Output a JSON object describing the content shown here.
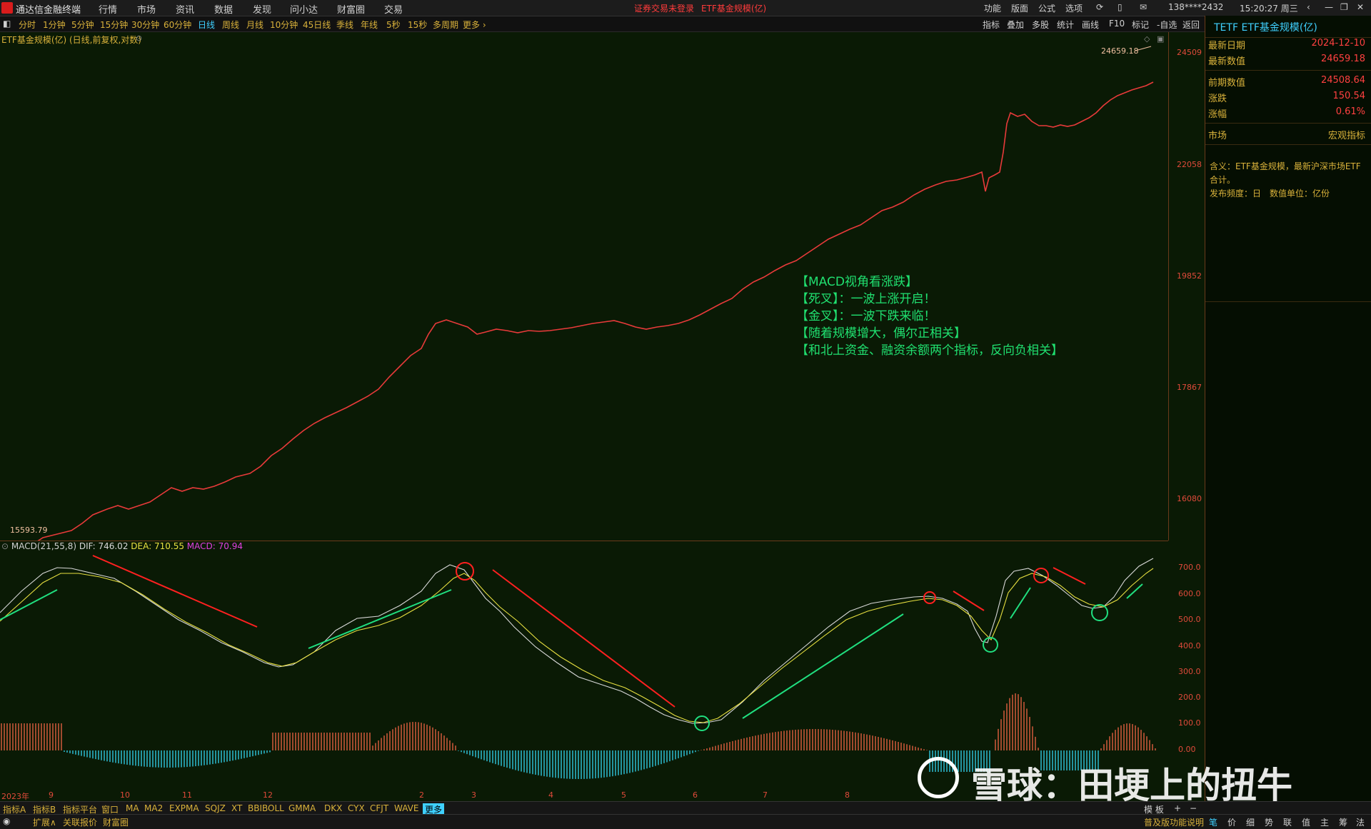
{
  "menubar": {
    "app_name": "通达信金融终端",
    "menus": [
      "行情",
      "市场",
      "资讯",
      "数据",
      "发现",
      "问小达",
      "财富圈",
      "交易"
    ],
    "status_text": "证券交易未登录",
    "current_item": "ETF基金规模(亿)",
    "right_items": [
      "功能",
      "版面",
      "公式",
      "选项"
    ],
    "account": "138****2432",
    "clock": "15:20:27 周三"
  },
  "periodbar": {
    "periods": [
      "分时",
      "1分钟",
      "5分钟",
      "15分钟",
      "30分钟",
      "60分钟",
      "日线",
      "周线",
      "月线",
      "10分钟",
      "45日线",
      "季线",
      "年线",
      "5秒",
      "15秒",
      "多周期",
      "更多 ›"
    ],
    "active_period": "日线",
    "tools": [
      "指标",
      "叠加",
      "多股",
      "统计",
      "画线",
      "F10",
      "标记",
      "-自选",
      "返回"
    ]
  },
  "main_chart": {
    "title": "ETF基金规模(亿) (日线,前复权,对数)",
    "last_value_label": "24659.18",
    "first_value_label": "15593.79",
    "y_ticks": [
      "24509",
      "22058",
      "19852",
      "17867",
      "16080"
    ]
  },
  "annotation": [
    "【MACD视角看涨跌】",
    "【死叉】：一波上涨开启！",
    "【金叉】：一波下跌来临！",
    "【随着规模增大，偶尔正相关】",
    "【和北上资金、融资余额两个指标，反向负相关】"
  ],
  "sub_chart": {
    "name": "MACD(21,55,8)",
    "dif": "DIF: 746.02",
    "dea": "DEA: 710.55",
    "macd": "MACD: 70.94",
    "y_ticks": [
      "700.0",
      "600.0",
      "500.0",
      "400.0",
      "300.0",
      "200.0",
      "100.0",
      "0.00"
    ],
    "x_ticks": [
      "2023年",
      "9",
      "10",
      "11",
      "12",
      "2",
      "3",
      "4",
      "5",
      "6",
      "7",
      "8"
    ]
  },
  "panel": {
    "code": "TETF",
    "name": "ETF基金规模(亿)",
    "rows1": [
      {
        "k": "最新日期",
        "v": "2024-12-10"
      },
      {
        "k": "最新数值",
        "v": "24659.18"
      }
    ],
    "rows2": [
      {
        "k": "前期数值",
        "v": "24508.64"
      },
      {
        "k": "涨跌",
        "v": "150.54"
      },
      {
        "k": "涨幅",
        "v": "0.61%"
      }
    ],
    "market_key": "市场",
    "market_val": "宏观指标",
    "desc_line1": "含义：ETF基金规模，最新沪深市场ETF合计。",
    "desc_line2": "发布频度：日　数值单位：亿份"
  },
  "tabs_row1": [
    "指标A",
    "指标B",
    "指标平台",
    "窗口",
    "MA",
    "MA2",
    "EXPMA",
    "SQJZ",
    "XT",
    "BBIBOLL",
    "GMMA",
    "DKX",
    "CYX",
    "CFJT",
    "WAVE",
    "更多"
  ],
  "tabs_row1_right": [
    "模 板",
    "+",
    "−"
  ],
  "tabs_row2": [
    "扩展∧",
    "关联报价",
    "财富圈"
  ],
  "tabs_row2_right": [
    "普及版功能说明",
    "笔",
    "价",
    "细",
    "势",
    "联",
    "值",
    "主",
    "筹",
    "法"
  ],
  "watermark": "雪球：田埂上的扭牛",
  "colors": {
    "price_line": "#e83a3a",
    "dif": "#d8d8d8",
    "dea": "#e8e040",
    "bar_pos": "#e06040",
    "bar_neg": "#30c8e0",
    "up_arrow": "#20e080",
    "down_arrow": "#ff2020"
  }
}
